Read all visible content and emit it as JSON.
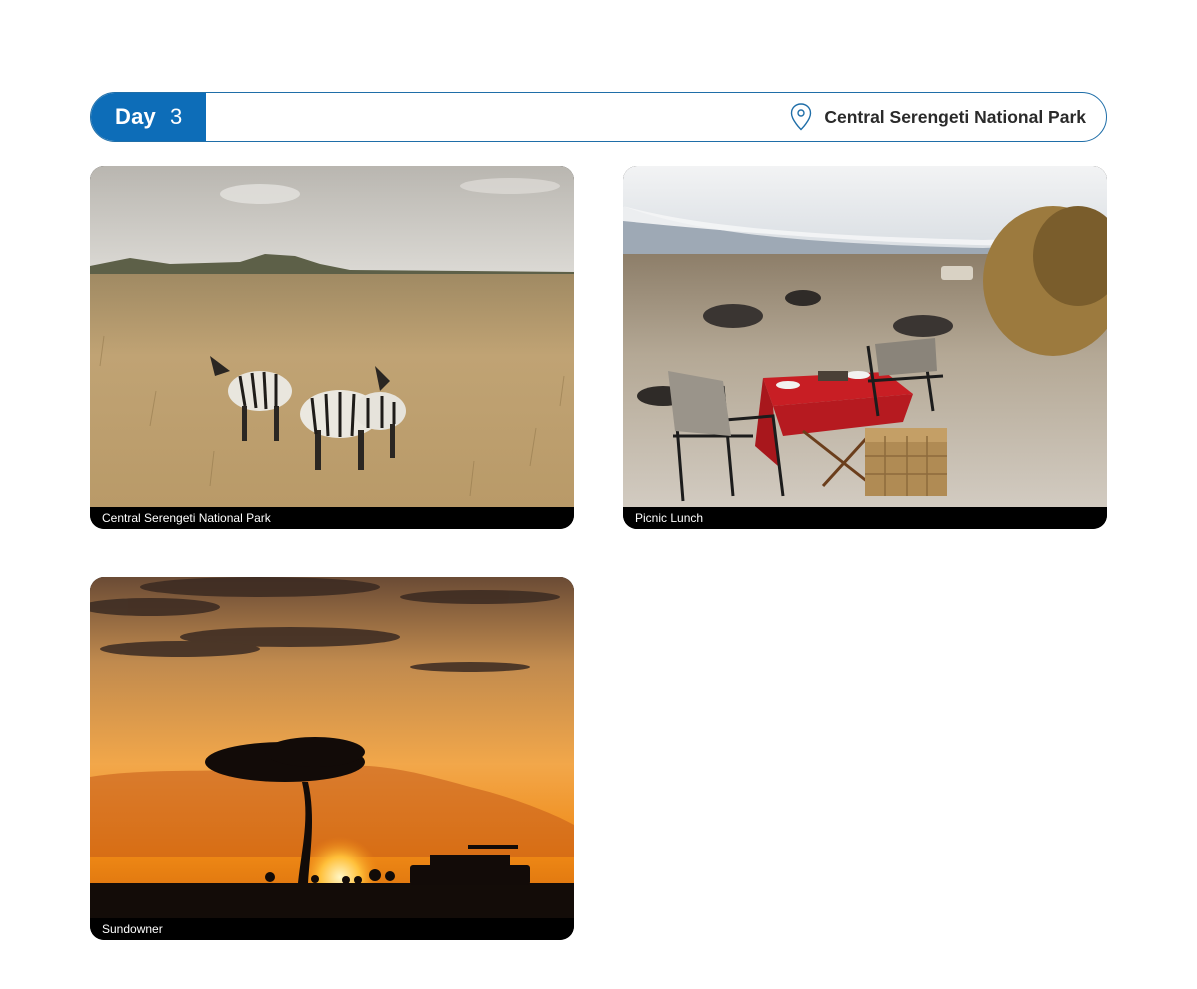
{
  "day": {
    "label": "Day",
    "number": "3"
  },
  "location": {
    "icon": "map-pin-icon",
    "name": "Central Serengeti National Park"
  },
  "accent_color": "#0d6db8",
  "photos": [
    {
      "caption": "Central Serengeti National Park",
      "scene": "zebras on savannah grassland"
    },
    {
      "caption": "Picnic Lunch",
      "scene": "bush picnic table with chairs and hamper"
    },
    {
      "caption": "Sundowner",
      "scene": "acacia tree silhouette at sunset with safari vehicle"
    }
  ]
}
